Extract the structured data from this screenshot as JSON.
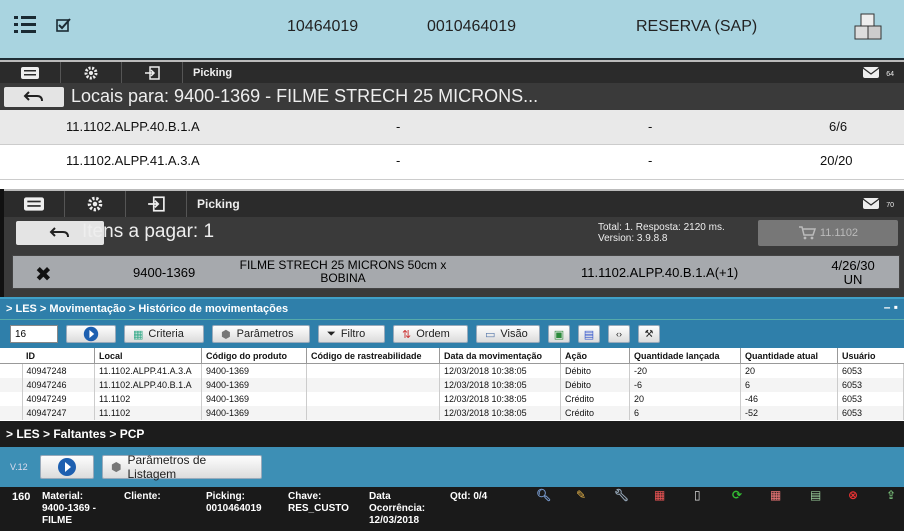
{
  "top": {
    "code1": "10464019",
    "code2": "0010464019",
    "status": "RESERVA (SAP)"
  },
  "locals": {
    "toolbar_label": "Picking",
    "mail_count": "64",
    "title": "Locais para: 9400-1369 - FILME STRECH 25 MICRONS...",
    "rows": [
      {
        "local": "11.1102.ALPP.40.B.1.A",
        "c2": "-",
        "c3": "-",
        "qty": "6/6"
      },
      {
        "local": "11.1102.ALPP.41.A.3.A",
        "c2": "-",
        "c3": "-",
        "qty": "20/20"
      }
    ]
  },
  "items": {
    "toolbar_label": "Picking",
    "mail_count": "70",
    "title": "Itens a pagar: 1",
    "info_line1": "Total: 1. Resposta: 2120 ms.",
    "info_line2": "Version: 3.9.8.8",
    "cart_label": "11.1102",
    "row": {
      "code": "9400-1369",
      "desc_line1": "FILME STRECH 25 MICRONS 50cm x",
      "desc_line2": "BOBINA",
      "local": "11.1102.ALPP.40.B.1.A(+1)",
      "qty_line1": "4/26/30",
      "qty_line2": "UN"
    }
  },
  "history": {
    "breadcrumb": "> LES > Movimentação > Histórico de movimentações",
    "page_size": "16",
    "buttons": {
      "criteria": "Criteria",
      "params": "Parâmetros",
      "filter": "Filtro",
      "order": "Ordem",
      "view": "Visão"
    },
    "columns": [
      "ID",
      "Local",
      "Código do produto",
      "Código de rastreabilidade",
      "Data da movimentação",
      "Ação",
      "Quantidade lançada",
      "Quantidade atual",
      "Usuário"
    ],
    "rows": [
      [
        "40947248",
        "11.1102.ALPP.41.A.3.A",
        "9400-1369",
        "",
        "12/03/2018 10:38:05",
        "Débito",
        "-20",
        "20",
        "6053"
      ],
      [
        "40947246",
        "11.1102.ALPP.40.B.1.A",
        "9400-1369",
        "",
        "12/03/2018 10:38:05",
        "Débito",
        "-6",
        "6",
        "6053"
      ],
      [
        "40947249",
        "11.1102",
        "9400-1369",
        "",
        "12/03/2018 10:38:05",
        "Crédito",
        "20",
        "-46",
        "6053"
      ],
      [
        "40947247",
        "11.1102",
        "9400-1369",
        "",
        "12/03/2018 10:38:05",
        "Crédito",
        "6",
        "-52",
        "6053"
      ]
    ]
  },
  "shortages": {
    "breadcrumb": "> LES > Faltantes > PCP",
    "version": "V.12",
    "params_button": "Parâmetros de Listagem",
    "row": {
      "num": "160",
      "material_label": "Material:",
      "material_value1": "9400-1369 -",
      "material_value2": "FILME",
      "client_label": "Cliente:",
      "picking_label": "Picking:",
      "picking_value": "0010464019",
      "key_label": "Chave:",
      "key_value": "RES_CUSTO",
      "date_label1": "Data",
      "date_label2": "Ocorrência:",
      "date_value": "12/03/2018",
      "qty": "Qtd: 0/4"
    }
  }
}
